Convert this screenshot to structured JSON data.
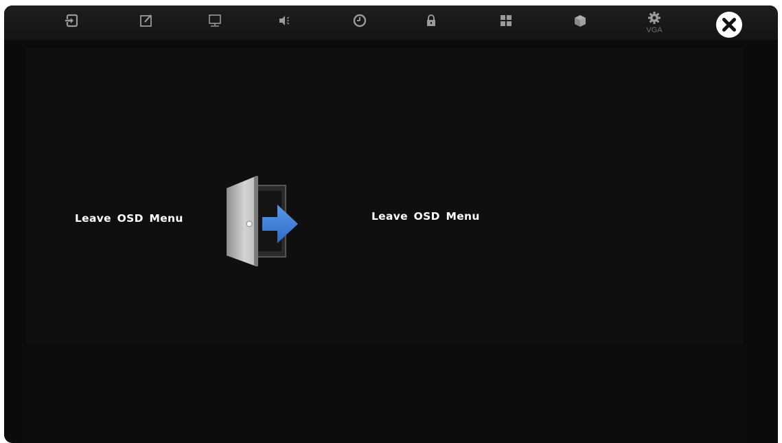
{
  "toolbar": {
    "tabs": [
      {
        "icon": "input-source-icon",
        "caption": ""
      },
      {
        "icon": "edit-icon",
        "caption": ""
      },
      {
        "icon": "display-icon",
        "caption": ""
      },
      {
        "icon": "audio-icon",
        "caption": ""
      },
      {
        "icon": "clock-icon",
        "caption": ""
      },
      {
        "icon": "lock-icon",
        "caption": ""
      },
      {
        "icon": "grid-icon",
        "caption": ""
      },
      {
        "icon": "box-icon",
        "caption": ""
      },
      {
        "icon": "gear-icon",
        "caption": "VGA"
      }
    ],
    "close_icon": "close-icon"
  },
  "main": {
    "item_label": "Leave OSD Menu",
    "description": "Leave OSD Menu",
    "illustration_icon": "exit-door-icon"
  },
  "colors": {
    "background": "#0b0b0b",
    "icon": "#9a9a9a",
    "accent_arrow": "#3f7fd9"
  }
}
